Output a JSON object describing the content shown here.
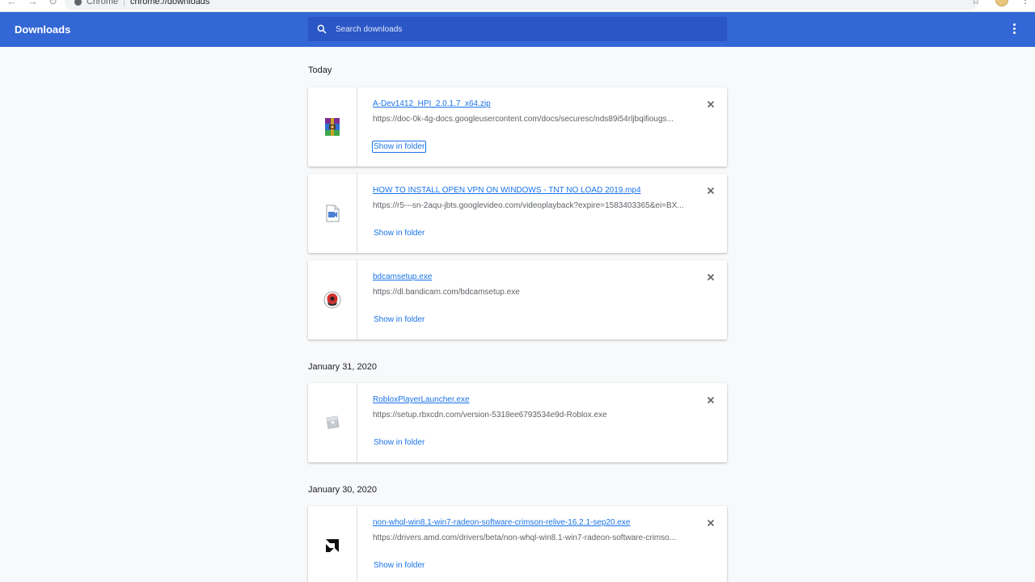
{
  "browser": {
    "host": "Chrome",
    "separator": "|",
    "path": "chrome://downloads"
  },
  "toolbar": {
    "title": "Downloads",
    "search_placeholder": "Search downloads"
  },
  "groups": [
    {
      "date": "Today",
      "items": [
        {
          "name": "A-Dev1412_HPI_2.0.1.7_x64.zip",
          "url": "https://doc-0k-4g-docs.googleusercontent.com/docs/securesc/nds89i54rljbqifiougs...",
          "action": "Show in folder",
          "icon": "winrar-archive-icon"
        },
        {
          "name": "HOW TO INSTALL OPEN VPN ON WINDOWS - TNT NO LOAD 2019.mp4",
          "url": "https://r5---sn-2aqu-jbts.googlevideo.com/videoplayback?expire=1583403365&ei=BX...",
          "action": "Show in folder",
          "icon": "video-file-icon"
        },
        {
          "name": "bdcamsetup.exe",
          "url": "https://dl.bandicam.com/bdcamsetup.exe",
          "action": "Show in folder",
          "icon": "bandicam-icon"
        }
      ]
    },
    {
      "date": "January 31, 2020",
      "items": [
        {
          "name": "RobloxPlayerLauncher.exe",
          "url": "https://setup.rbxcdn.com/version-5318ee6793534e9d-Roblox.exe",
          "action": "Show in folder",
          "icon": "roblox-icon"
        }
      ]
    },
    {
      "date": "January 30, 2020",
      "items": [
        {
          "name": "non-whql-win8.1-win7-radeon-software-crimson-relive-16.2.1-sep20.exe",
          "url": "https://drivers.amd.com/drivers/beta/non-whql-win8.1-win7-radeon-software-crimso...",
          "action": "Show in folder",
          "icon": "amd-logo-icon"
        }
      ]
    }
  ],
  "colors": {
    "toolbar": "#3367d6",
    "search_box": "#2a56c6",
    "link": "#1a73e8"
  }
}
